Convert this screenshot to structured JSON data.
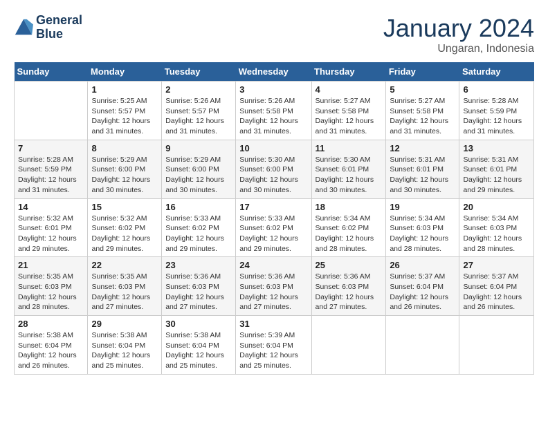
{
  "header": {
    "logo_line1": "General",
    "logo_line2": "Blue",
    "month": "January 2024",
    "location": "Ungaran, Indonesia"
  },
  "weekdays": [
    "Sunday",
    "Monday",
    "Tuesday",
    "Wednesday",
    "Thursday",
    "Friday",
    "Saturday"
  ],
  "weeks": [
    [
      {
        "day": "",
        "sunrise": "",
        "sunset": "",
        "daylight": ""
      },
      {
        "day": "1",
        "sunrise": "Sunrise: 5:25 AM",
        "sunset": "Sunset: 5:57 PM",
        "daylight": "Daylight: 12 hours and 31 minutes."
      },
      {
        "day": "2",
        "sunrise": "Sunrise: 5:26 AM",
        "sunset": "Sunset: 5:57 PM",
        "daylight": "Daylight: 12 hours and 31 minutes."
      },
      {
        "day": "3",
        "sunrise": "Sunrise: 5:26 AM",
        "sunset": "Sunset: 5:58 PM",
        "daylight": "Daylight: 12 hours and 31 minutes."
      },
      {
        "day": "4",
        "sunrise": "Sunrise: 5:27 AM",
        "sunset": "Sunset: 5:58 PM",
        "daylight": "Daylight: 12 hours and 31 minutes."
      },
      {
        "day": "5",
        "sunrise": "Sunrise: 5:27 AM",
        "sunset": "Sunset: 5:58 PM",
        "daylight": "Daylight: 12 hours and 31 minutes."
      },
      {
        "day": "6",
        "sunrise": "Sunrise: 5:28 AM",
        "sunset": "Sunset: 5:59 PM",
        "daylight": "Daylight: 12 hours and 31 minutes."
      }
    ],
    [
      {
        "day": "7",
        "sunrise": "Sunrise: 5:28 AM",
        "sunset": "Sunset: 5:59 PM",
        "daylight": "Daylight: 12 hours and 31 minutes."
      },
      {
        "day": "8",
        "sunrise": "Sunrise: 5:29 AM",
        "sunset": "Sunset: 6:00 PM",
        "daylight": "Daylight: 12 hours and 30 minutes."
      },
      {
        "day": "9",
        "sunrise": "Sunrise: 5:29 AM",
        "sunset": "Sunset: 6:00 PM",
        "daylight": "Daylight: 12 hours and 30 minutes."
      },
      {
        "day": "10",
        "sunrise": "Sunrise: 5:30 AM",
        "sunset": "Sunset: 6:00 PM",
        "daylight": "Daylight: 12 hours and 30 minutes."
      },
      {
        "day": "11",
        "sunrise": "Sunrise: 5:30 AM",
        "sunset": "Sunset: 6:01 PM",
        "daylight": "Daylight: 12 hours and 30 minutes."
      },
      {
        "day": "12",
        "sunrise": "Sunrise: 5:31 AM",
        "sunset": "Sunset: 6:01 PM",
        "daylight": "Daylight: 12 hours and 30 minutes."
      },
      {
        "day": "13",
        "sunrise": "Sunrise: 5:31 AM",
        "sunset": "Sunset: 6:01 PM",
        "daylight": "Daylight: 12 hours and 29 minutes."
      }
    ],
    [
      {
        "day": "14",
        "sunrise": "Sunrise: 5:32 AM",
        "sunset": "Sunset: 6:01 PM",
        "daylight": "Daylight: 12 hours and 29 minutes."
      },
      {
        "day": "15",
        "sunrise": "Sunrise: 5:32 AM",
        "sunset": "Sunset: 6:02 PM",
        "daylight": "Daylight: 12 hours and 29 minutes."
      },
      {
        "day": "16",
        "sunrise": "Sunrise: 5:33 AM",
        "sunset": "Sunset: 6:02 PM",
        "daylight": "Daylight: 12 hours and 29 minutes."
      },
      {
        "day": "17",
        "sunrise": "Sunrise: 5:33 AM",
        "sunset": "Sunset: 6:02 PM",
        "daylight": "Daylight: 12 hours and 29 minutes."
      },
      {
        "day": "18",
        "sunrise": "Sunrise: 5:34 AM",
        "sunset": "Sunset: 6:02 PM",
        "daylight": "Daylight: 12 hours and 28 minutes."
      },
      {
        "day": "19",
        "sunrise": "Sunrise: 5:34 AM",
        "sunset": "Sunset: 6:03 PM",
        "daylight": "Daylight: 12 hours and 28 minutes."
      },
      {
        "day": "20",
        "sunrise": "Sunrise: 5:34 AM",
        "sunset": "Sunset: 6:03 PM",
        "daylight": "Daylight: 12 hours and 28 minutes."
      }
    ],
    [
      {
        "day": "21",
        "sunrise": "Sunrise: 5:35 AM",
        "sunset": "Sunset: 6:03 PM",
        "daylight": "Daylight: 12 hours and 28 minutes."
      },
      {
        "day": "22",
        "sunrise": "Sunrise: 5:35 AM",
        "sunset": "Sunset: 6:03 PM",
        "daylight": "Daylight: 12 hours and 27 minutes."
      },
      {
        "day": "23",
        "sunrise": "Sunrise: 5:36 AM",
        "sunset": "Sunset: 6:03 PM",
        "daylight": "Daylight: 12 hours and 27 minutes."
      },
      {
        "day": "24",
        "sunrise": "Sunrise: 5:36 AM",
        "sunset": "Sunset: 6:03 PM",
        "daylight": "Daylight: 12 hours and 27 minutes."
      },
      {
        "day": "25",
        "sunrise": "Sunrise: 5:36 AM",
        "sunset": "Sunset: 6:03 PM",
        "daylight": "Daylight: 12 hours and 27 minutes."
      },
      {
        "day": "26",
        "sunrise": "Sunrise: 5:37 AM",
        "sunset": "Sunset: 6:04 PM",
        "daylight": "Daylight: 12 hours and 26 minutes."
      },
      {
        "day": "27",
        "sunrise": "Sunrise: 5:37 AM",
        "sunset": "Sunset: 6:04 PM",
        "daylight": "Daylight: 12 hours and 26 minutes."
      }
    ],
    [
      {
        "day": "28",
        "sunrise": "Sunrise: 5:38 AM",
        "sunset": "Sunset: 6:04 PM",
        "daylight": "Daylight: 12 hours and 26 minutes."
      },
      {
        "day": "29",
        "sunrise": "Sunrise: 5:38 AM",
        "sunset": "Sunset: 6:04 PM",
        "daylight": "Daylight: 12 hours and 25 minutes."
      },
      {
        "day": "30",
        "sunrise": "Sunrise: 5:38 AM",
        "sunset": "Sunset: 6:04 PM",
        "daylight": "Daylight: 12 hours and 25 minutes."
      },
      {
        "day": "31",
        "sunrise": "Sunrise: 5:39 AM",
        "sunset": "Sunset: 6:04 PM",
        "daylight": "Daylight: 12 hours and 25 minutes."
      },
      {
        "day": "",
        "sunrise": "",
        "sunset": "",
        "daylight": ""
      },
      {
        "day": "",
        "sunrise": "",
        "sunset": "",
        "daylight": ""
      },
      {
        "day": "",
        "sunrise": "",
        "sunset": "",
        "daylight": ""
      }
    ]
  ]
}
